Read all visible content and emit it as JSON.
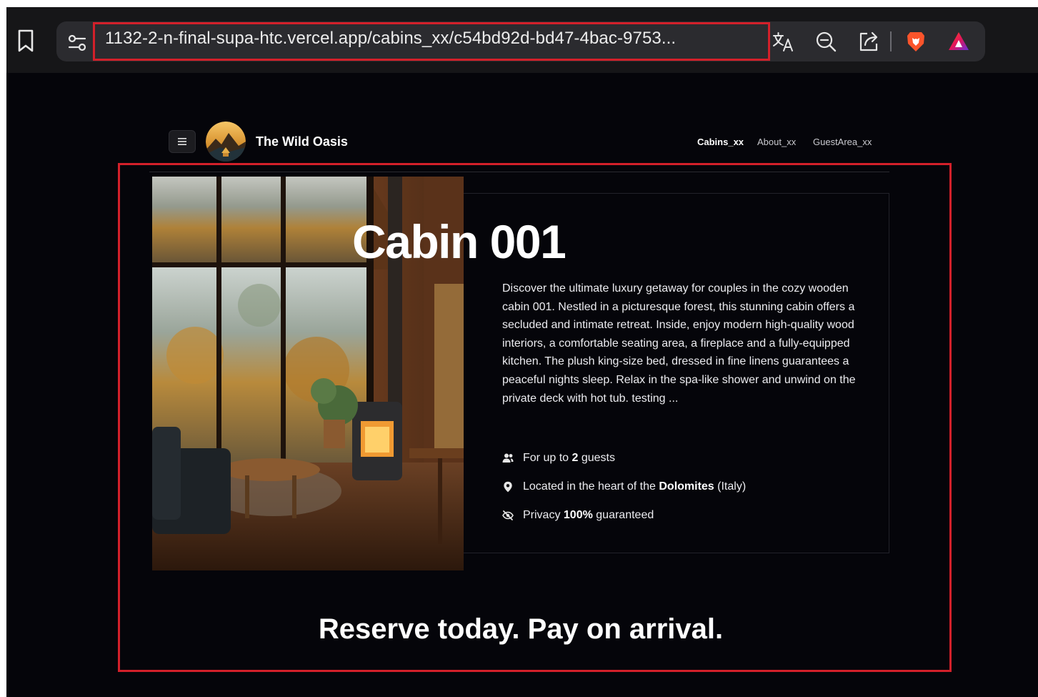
{
  "browser": {
    "url": "1132-2-n-final-supa-htc.vercel.app/cabins_xx/c54bd92d-bd47-4bac-9753..."
  },
  "site": {
    "brand": "The Wild Oasis",
    "nav": [
      "Cabins_xx",
      "About_xx",
      "GuestArea_xx"
    ],
    "active_nav": "Cabins_xx"
  },
  "cabin": {
    "title": "Cabin 001",
    "description": "Discover the ultimate luxury getaway for couples in the cozy wooden cabin 001. Nestled in a picturesque forest, this stunning cabin offers a secluded and intimate retreat. Inside, enjoy modern high-quality wood interiors, a comfortable seating area, a fireplace and a fully-equipped kitchen. The plush king-size bed, dressed in fine linens guarantees a peaceful nights sleep. Relax in the spa-like shower and unwind on the private deck with hot tub. testing ...",
    "guests": {
      "prefix": "For up to ",
      "count": "2",
      "suffix": " guests"
    },
    "location": {
      "prefix": "Located in the heart of the ",
      "place": "Dolomites",
      "suffix": " (Italy)"
    },
    "privacy": {
      "prefix": "Privacy ",
      "value": "100%",
      "suffix": " guaranteed"
    }
  },
  "cta": "Reserve today. Pay on arrival.",
  "icons": {
    "bookmark": "bookmark-icon",
    "tune": "site-settings-icon",
    "translate": "translate-icon",
    "zoom": "zoom-out-icon",
    "share": "share-icon",
    "brave": "brave-lion-icon",
    "rewards": "brave-rewards-icon",
    "menu": "hamburger-menu-icon",
    "guests": "users-icon",
    "location": "map-pin-icon",
    "privacy": "eye-slash-icon"
  },
  "colors": {
    "background": "#05050a",
    "highlight": "#d3202a",
    "brave_orange": "#fb542b"
  }
}
